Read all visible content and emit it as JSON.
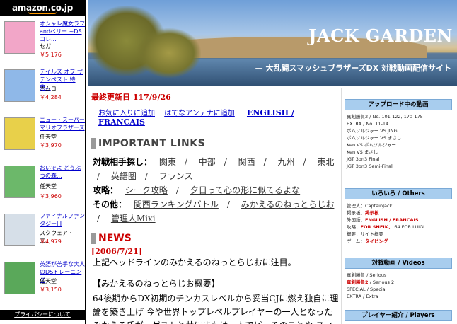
{
  "amazon": {
    "logo": "amazon.co.jp",
    "products": [
      {
        "name": "オシャレ魔女ラブandベリー ~DSコレ...",
        "maker": "セガ",
        "price": "￥5,176",
        "color": "#f2a6c8"
      },
      {
        "name": "テイルズ オブ ザ テンペスト 特典...",
        "maker": "ナムコ",
        "price": "￥4,284",
        "color": "#8fb8e8"
      },
      {
        "name": "ニュー・スーパーマリオブラザーズ",
        "maker": "任天堂",
        "price": "￥3,970",
        "color": "#e8d04a"
      },
      {
        "name": "おいでよ どうぶつの森...",
        "maker": "任天堂",
        "price": "￥3,960",
        "color": "#6cb86a"
      },
      {
        "name": "ファイナルファンタジーIII",
        "maker": "スクウェア・エ...",
        "price": "￥4,979",
        "color": "#d6dfe8"
      },
      {
        "name": "英語が苦手な大人のDSトレーニング",
        "maker": "任天堂",
        "price": "￥3,150",
        "color": "#5aa85a"
      }
    ],
    "privacy": "プライバシーについて"
  },
  "banner": {
    "title": "JACK GARDEN",
    "subtitle": "— 大乱闘スマッシュブラザーズDX 対戦動画配信サイト"
  },
  "main": {
    "updated": "最終更新日 117/9/26",
    "top_links": [
      "お気に入りに追加",
      "はてなアンテナに追加",
      "ENGLISH / FRANCAIS"
    ],
    "links_heading": "IMPORTANT LINKS",
    "links": {
      "row1_label": "対戦相手探し：",
      "row1": [
        "関東",
        "中部",
        "関西",
        "九州",
        "東北",
        "英語圏",
        "フランス"
      ],
      "row2_label": "攻略：",
      "row2": [
        "シーク攻略",
        "夕日って心の形に似てるよな"
      ],
      "row3_label": "その他：",
      "row3": [
        "関西ランキングバトル",
        "みかえるのねっとらじお",
        "管理人Mixi"
      ]
    },
    "news_heading": "NEWS",
    "news_date": "[2006/7/21]",
    "news_line": "上記ヘッドラインのみかえるのねっとらじおに注目。",
    "news_sub": "【みかえるのねっとらじお概要】",
    "news_body": "64後期からDX初期のチンカスレベルから妥当CJに燃え独自に理論を築き上げ 今や世界トップレベルプレイヤーの一人となったみかえる氏が、ゲストと共にまたは一人でピーチのことや スマ"
  },
  "right": {
    "box1": {
      "heading": "アップロード中の動画",
      "lines": [
        "真剣勝負2 / No. 101-122, 170-175",
        "EXTRA / No. 11-14",
        "ボムソルジャー VS JING",
        "ボムソルジャー VS まさし",
        "Ken VS ボムソルジャー",
        "Ken VS まさし",
        "JGT 3on3 Final",
        "JGT 3on3 Semi-Final"
      ]
    },
    "box2": {
      "heading": "いろいろ / Others",
      "l1_label": "管理人：",
      "l1_value": "CaptainJack",
      "l2_label": "掲示板：",
      "l2_value": "掲示板",
      "l3_label": "外国語：",
      "l3_value": "ENGLISH / FRANCAIS",
      "l4_label": "攻略：",
      "l4_value": "FOR SHEIK、",
      "l4_value2": "64 FOR LUIGI",
      "l5_label": "概要：",
      "l5_value": "サイト概要",
      "l6_label": "ゲーム：",
      "l6_value": "タイピング"
    },
    "box3": {
      "heading": "対戦動画 / Videos",
      "l1": "真剣勝負 / Serious",
      "l2_red": "真剣勝負2",
      "l2_rest": " / Serious 2",
      "l3": "SPECIAL / Special",
      "l4": "EXTRA / Extra"
    },
    "box4": {
      "heading": "プレイヤー紹介 / Players"
    }
  }
}
